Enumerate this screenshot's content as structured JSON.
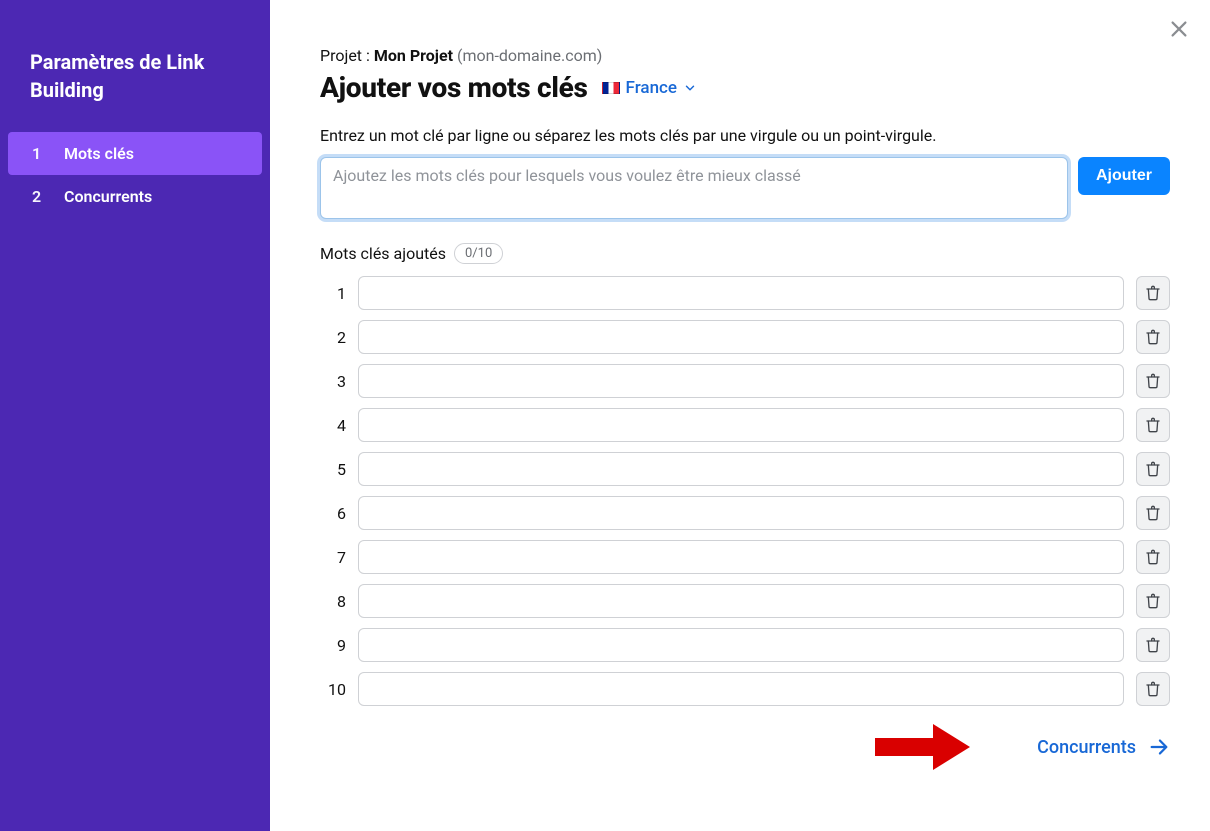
{
  "sidebar": {
    "title": "Paramètres de Link Building",
    "items": [
      {
        "num": "1",
        "label": "Mots clés",
        "active": true
      },
      {
        "num": "2",
        "label": "Concurrents",
        "active": false
      }
    ]
  },
  "main": {
    "project_prefix": "Projet : ",
    "project_name": "Mon Projet",
    "project_domain": "(mon-domaine.com)",
    "heading": "Ajouter vos mots clés",
    "country": "France",
    "instruction": "Entrez un mot clé par ligne ou séparez les mots clés par une virgule ou un point-virgule.",
    "textarea_placeholder": "Ajoutez les mots clés pour lesquels vous voulez être mieux classé",
    "add_button": "Ajouter",
    "added_label": "Mots clés ajoutés",
    "count": "0/10",
    "rows": [
      {
        "num": "1",
        "value": ""
      },
      {
        "num": "2",
        "value": ""
      },
      {
        "num": "3",
        "value": ""
      },
      {
        "num": "4",
        "value": ""
      },
      {
        "num": "5",
        "value": ""
      },
      {
        "num": "6",
        "value": ""
      },
      {
        "num": "7",
        "value": ""
      },
      {
        "num": "8",
        "value": ""
      },
      {
        "num": "9",
        "value": ""
      },
      {
        "num": "10",
        "value": ""
      }
    ],
    "next_label": "Concurrents"
  }
}
